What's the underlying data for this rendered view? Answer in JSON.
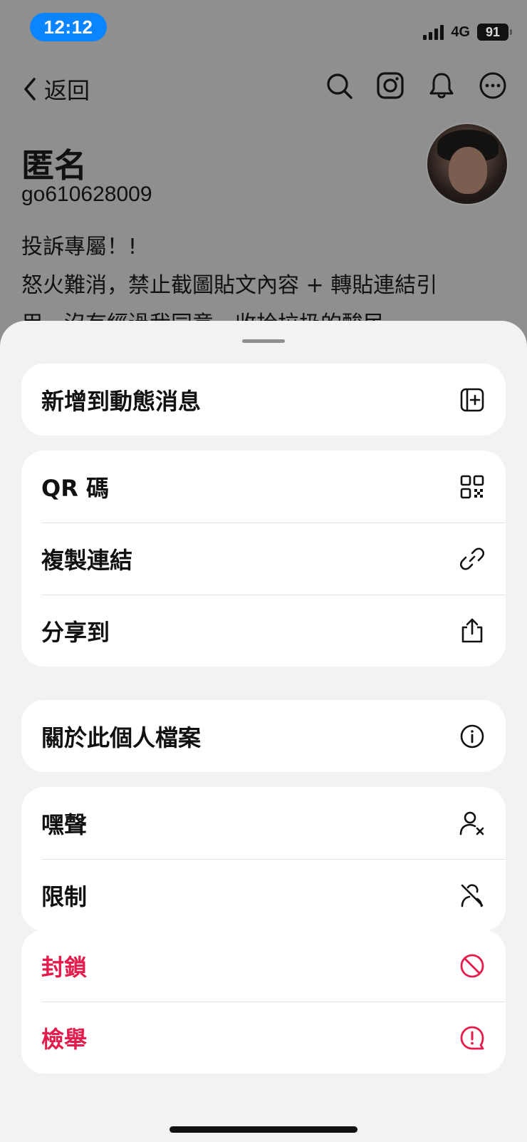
{
  "status_bar": {
    "time": "12:12",
    "network": "4G",
    "battery": "91"
  },
  "nav": {
    "back_label": "返回",
    "icons": [
      "search-icon",
      "instagram-icon",
      "bell-icon",
      "more-icon"
    ]
  },
  "profile": {
    "name": "匿名",
    "handle": "go610628009",
    "bio_line1": "投訴專屬！!",
    "bio_line2": "怒火難消，禁止截圖貼文內容 + 轉貼連結引",
    "bio_line3": "用，沒有經過我同意，收拾垃圾的酸民。"
  },
  "sheet": {
    "groups": [
      [
        {
          "label": "新增到動態消息",
          "icon": "add-feed-icon"
        }
      ],
      [
        {
          "label": "QR 碼",
          "icon": "qr-code-icon"
        },
        {
          "label": "複製連結",
          "icon": "link-icon"
        },
        {
          "label": "分享到",
          "icon": "share-icon"
        }
      ],
      [
        {
          "label": "關於此個人檔案",
          "icon": "info-icon"
        }
      ],
      [
        {
          "label": "嘿聲",
          "icon": "mute-user-icon"
        },
        {
          "label": "限制",
          "icon": "restrict-icon"
        }
      ],
      [
        {
          "label": "封鎖",
          "icon": "block-icon",
          "danger": true
        },
        {
          "label": "檢舉",
          "icon": "report-icon",
          "danger": true
        }
      ]
    ]
  },
  "colors": {
    "accent": "#0a84ff",
    "danger": "#e31c4b",
    "sheet_bg": "#f2f2f2",
    "dim_bg": "#8f8f8f"
  }
}
